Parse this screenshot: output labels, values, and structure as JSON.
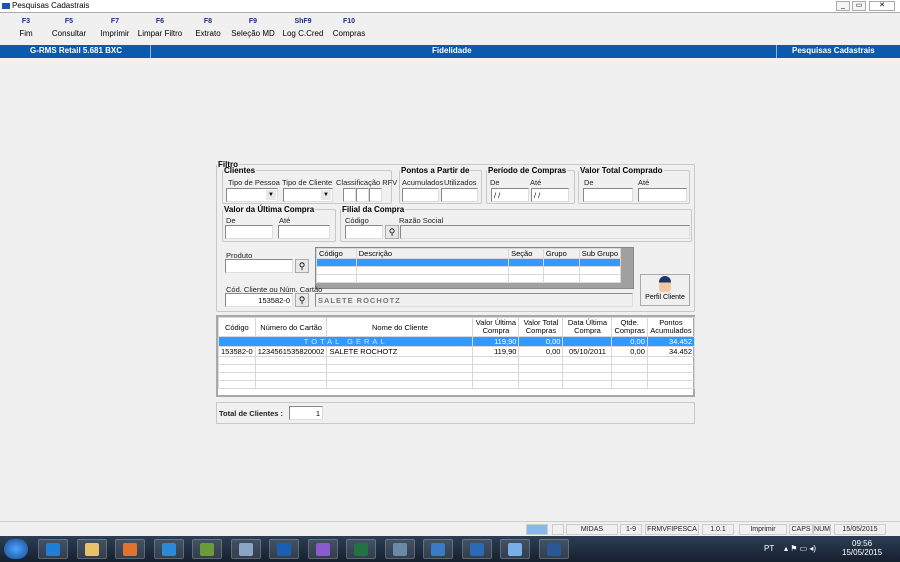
{
  "window": {
    "title": "Pesquisas Cadastrais",
    "controls": [
      "_",
      "▭",
      "✕"
    ]
  },
  "toolbar": [
    {
      "key": "F3",
      "label": "Fim"
    },
    {
      "key": "F5",
      "label": "Consultar"
    },
    {
      "key": "F7",
      "label": "Imprimir"
    },
    {
      "key": "F6",
      "label": "Limpar Filtro"
    },
    {
      "key": "F8",
      "label": "Extrato"
    },
    {
      "key": "F9",
      "label": "Seleção MD"
    },
    {
      "key": "ShF9",
      "label": "Log C.Cred"
    },
    {
      "key": "F10",
      "label": "Compras"
    }
  ],
  "header": {
    "app": "G-RMS Retail 5.681 BXC",
    "module": "Fidelidade",
    "screen": "Pesquisas Cadastrais"
  },
  "filter": {
    "title": "Filtro",
    "clientes": {
      "title": "Clientes",
      "tipo_pessoa": "Tipo de Pessoa",
      "tipo_cliente": "Tipo de Cliente",
      "rfv": "Classificação RFV"
    },
    "pontos": {
      "title": "Pontos a Partir de",
      "acumulados": "Acumulados",
      "utilizados": "Utilizados"
    },
    "periodo": {
      "title": "Período de Compras",
      "de": "De",
      "ate": "Até",
      "de_value": " / /",
      "ate_value": " / /"
    },
    "valor_total": {
      "title": "Valor Total Comprado",
      "de": "De",
      "ate": "Até"
    },
    "ultima": {
      "title": "Valor da Última Compra",
      "de": "De",
      "ate": "Até"
    },
    "filial": {
      "title": "Filial da Compra",
      "codigo": "Código",
      "razao": "Razão Social"
    },
    "produto": {
      "label": "Produto",
      "columns": [
        "Código",
        "Descrição",
        "Seção",
        "Grupo",
        "Sub Grupo"
      ]
    },
    "cliente": {
      "label": "Cód. Cliente ou Núm. Cartão",
      "value": "153582-0",
      "name": "SALETE ROCHOTZ"
    },
    "perfil_button": "Perfil Cliente"
  },
  "results": {
    "columns": [
      "Código",
      "Número do Cartão",
      "Nome do Cliente",
      "Valor Última Compra",
      "Valor Total Compras",
      "Data Última Compra",
      "Qtde. Compras",
      "Pontos Acumulados"
    ],
    "total_row": {
      "label": "TOTAL GERAL",
      "valor_ultima": "119,90",
      "valor_total": "0,00",
      "data": "",
      "qtde": "0,00",
      "pontos": "34.452"
    },
    "rows": [
      {
        "codigo": "153582-0",
        "cartao": "1234561535820002",
        "nome": "SALETE ROCHOTZ",
        "valor_ultima": "119,90",
        "valor_total": "0,00",
        "data": "05/10/2011",
        "qtde": "0,00",
        "pontos": "34.452"
      }
    ]
  },
  "total_clientes": {
    "label": "Total de Clientes :",
    "value": "1"
  },
  "statusbar": [
    "MIDAS",
    "1-9",
    "FRMVFIPESCA",
    "1.0.1",
    "Imprimir",
    "CAPS",
    "NUM",
    "15/05/2015"
  ],
  "taskbar": {
    "lang": "PT",
    "time": "09:56",
    "date": "15/05/2015"
  }
}
